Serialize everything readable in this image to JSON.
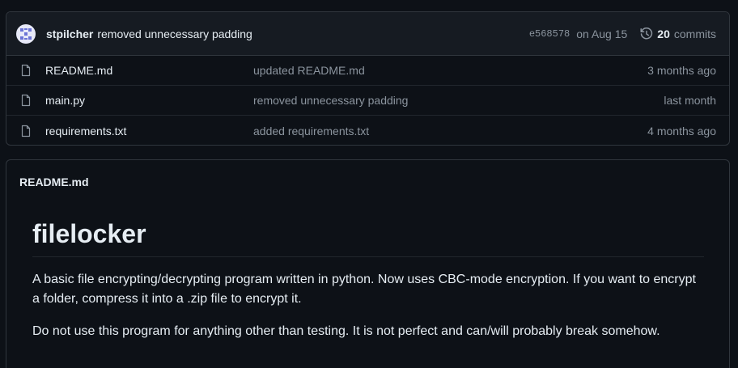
{
  "commit": {
    "author": "stpilcher",
    "message": "removed unnecessary padding",
    "sha": "e568578",
    "date": "on Aug 15",
    "commit_count": "20",
    "commit_word": "commits",
    "icon": "history-icon"
  },
  "files": [
    {
      "name": "README.md",
      "message": "updated README.md",
      "age": "3 months ago",
      "icon": "file-icon"
    },
    {
      "name": "main.py",
      "message": "removed unnecessary padding",
      "age": "last month",
      "icon": "file-icon"
    },
    {
      "name": "requirements.txt",
      "message": "added requirements.txt",
      "age": "4 months ago",
      "icon": "file-icon"
    }
  ],
  "readme": {
    "filename": "README.md",
    "title": "filelocker",
    "paragraphs": [
      "A basic file encrypting/decrypting program written in python. Now uses CBC-mode encryption. If you want to encrypt a folder, compress it into a .zip file to encrypt it.",
      "Do not use this program for anything other than testing. It is not perfect and can/will probably break somehow."
    ]
  },
  "colors": {
    "background": "#0d1117",
    "header_bg": "#161b22",
    "border": "#30363d",
    "text": "#e6edf3",
    "muted": "#8b949e"
  }
}
